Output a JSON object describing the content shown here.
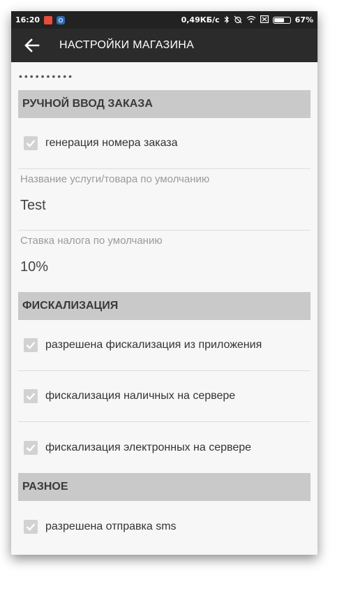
{
  "status_bar": {
    "time": "16:20",
    "network_speed": "0,49КБ/с",
    "battery_percent": "67%",
    "battery_level": 0.67,
    "icons": [
      "app-notification-icon",
      "settings-notification-icon",
      "bluetooth-icon",
      "alarm-off-icon",
      "wifi-icon",
      "sim-off-icon",
      "battery-icon"
    ]
  },
  "app_bar": {
    "title": "НАСТРОЙКИ МАГАЗИНА",
    "back_icon": "arrow-left-icon"
  },
  "password_mask": "••••••••••",
  "sections": {
    "manual_order": {
      "header": "РУЧНОЙ ВВОД ЗАКАЗА",
      "order_number_generation": {
        "label": "генерация номера заказа",
        "checked": true
      },
      "default_item_name": {
        "label": "Название услуги/товара по умолчанию",
        "value": "Test"
      },
      "default_tax_rate": {
        "label": "Ставка налога по умолчанию",
        "value": "10%"
      }
    },
    "fiscalization": {
      "header": "ФИСКАЛИЗАЦИЯ",
      "items": [
        {
          "label": "разрешена фискализация из приложения",
          "checked": true
        },
        {
          "label": "фискализация наличных на сервере",
          "checked": true
        },
        {
          "label": "фискализация электронных на сервере",
          "checked": true
        }
      ]
    },
    "misc": {
      "header": "РАЗНОЕ",
      "items": [
        {
          "label": "разрешена отправка sms",
          "checked": true
        }
      ]
    }
  },
  "colors": {
    "app_bar": "#2b2b2b",
    "status_bar": "#222222",
    "section_header": "#c9c9c9",
    "background": "#f7f7f7",
    "checkbox": "#d2d2d2"
  }
}
